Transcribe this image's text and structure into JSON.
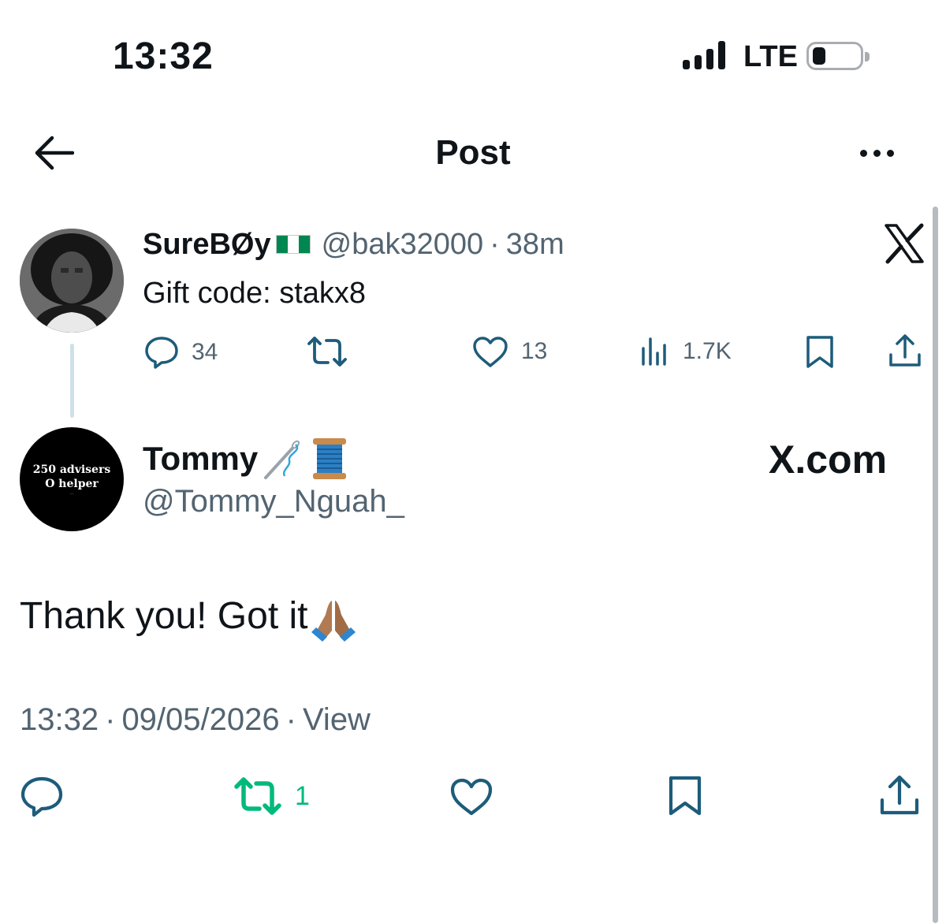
{
  "status_bar": {
    "time": "13:32",
    "network": "LTE"
  },
  "header": {
    "title": "Post"
  },
  "quoted_post": {
    "author_name": "SureBØy",
    "handle": "@bak32000",
    "separator": "·",
    "time_ago": "38m",
    "text": "Gift code: stakx8",
    "replies": "34",
    "likes": "13",
    "views": "1.7K"
  },
  "main_post": {
    "author_name": "Tommy",
    "handle": "@Tommy_Nguah_",
    "avatar_text_line1": "250 advisers",
    "avatar_text_line2": "O helper",
    "watermark": "X.com",
    "text": "Thank you! Got it",
    "timestamp_time": "13:32",
    "timestamp_date": "09/05/2026",
    "separator": "·",
    "view_link": "View",
    "reposts": "1"
  },
  "colors": {
    "text": "#0f1419",
    "secondary": "#536471",
    "accent_blue": "#1d5c7a",
    "repost_green": "#00ba7c",
    "thread_line": "#cfe0ea"
  },
  "icons": [
    "back-arrow-icon",
    "more-icon",
    "x-logo-icon",
    "reply-icon",
    "repost-icon",
    "like-icon",
    "views-icon",
    "bookmark-icon",
    "share-icon",
    "needle-icon",
    "thread-spool-icon",
    "pray-hands-icon"
  ]
}
